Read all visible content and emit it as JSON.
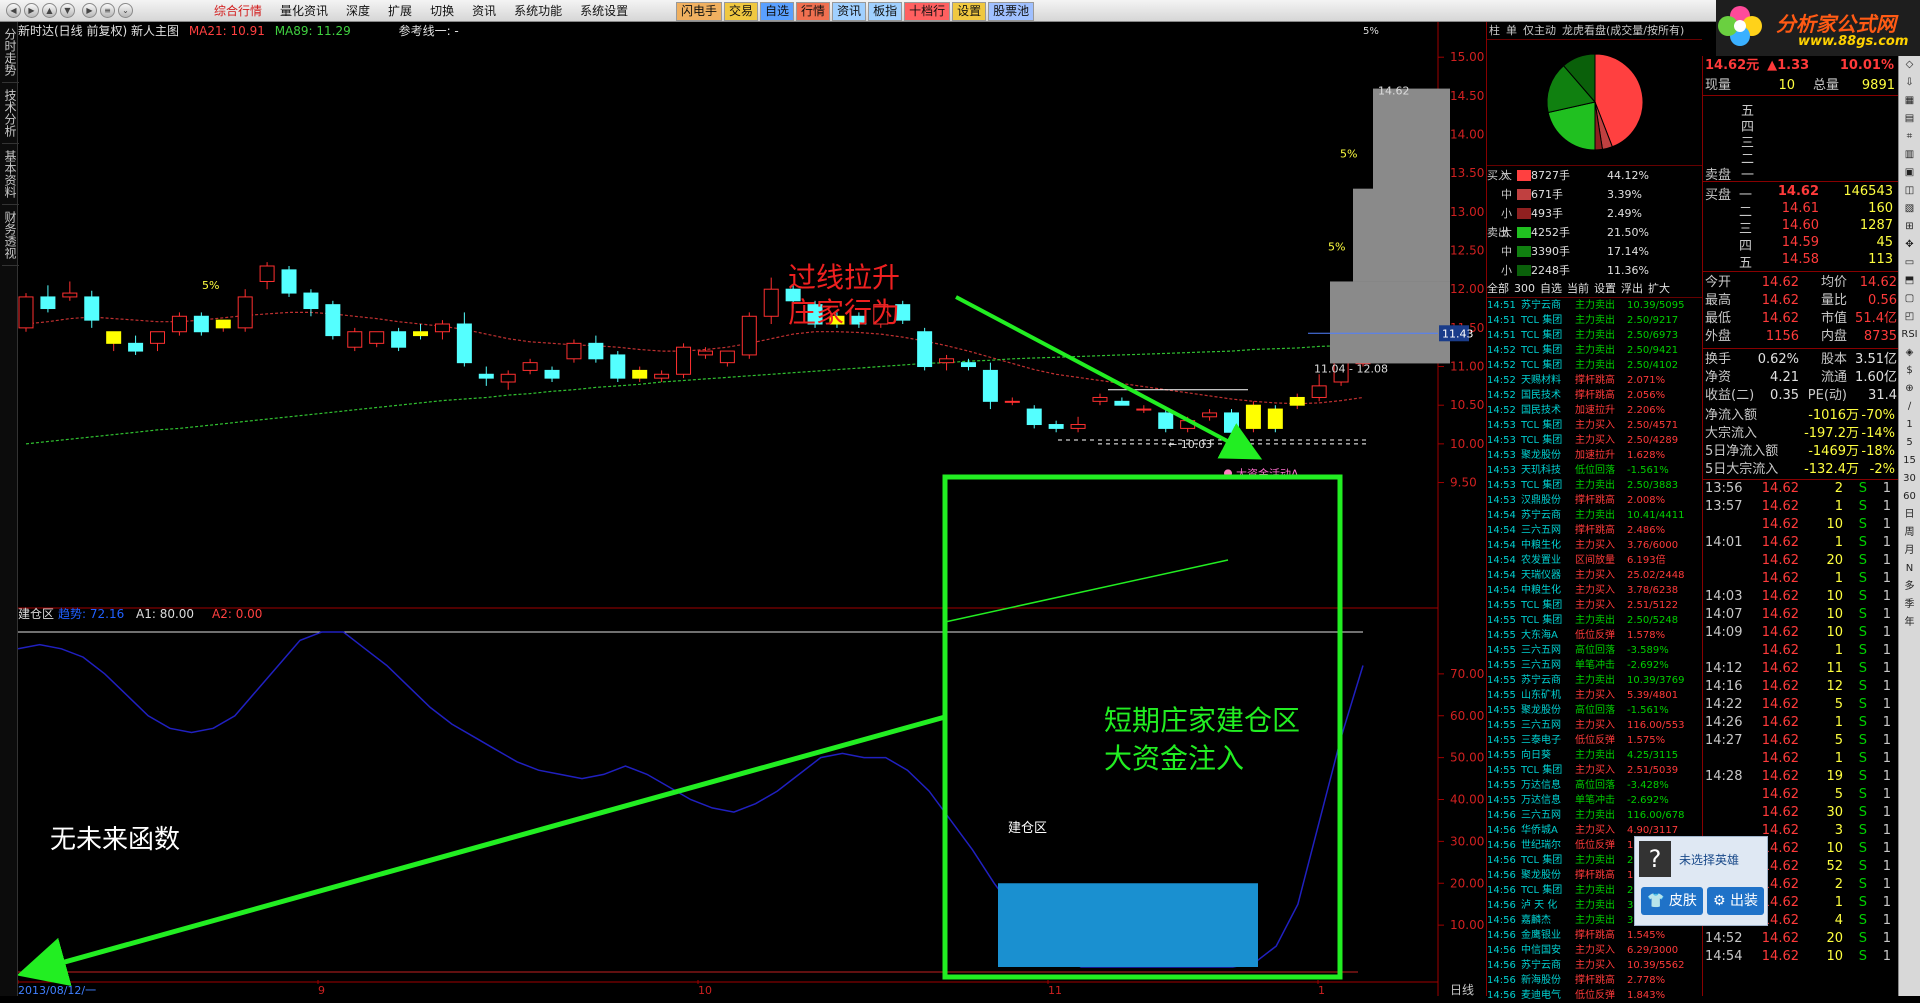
{
  "app": {
    "logo_name": "分析家公式网",
    "logo_url": "www.88gs.com"
  },
  "menu": [
    "综合行情",
    "量化资讯",
    "深度",
    "扩展",
    "切换",
    "资讯",
    "系统功能",
    "系统设置"
  ],
  "quick_buttons": [
    "闪电手",
    "交易",
    "自选",
    "行情",
    "资讯",
    "板指",
    "十档行",
    "设置",
    "股票池"
  ],
  "side_tabs": [
    "分时走势",
    "技术分析",
    "基本资料",
    "财务透视"
  ],
  "title": {
    "name": "新时达(日线 前复权) 新人主图",
    "ma21": "MA21: 10.91",
    "ma89": "MA89: 11.29",
    "ref": "参考线一: -"
  },
  "sub_title": {
    "name": "建仓区",
    "trend": "趋势: 72.16",
    "a1": "A1: 80.00",
    "a2": "A2: 0.00"
  },
  "price_axis": [
    "15.00",
    "14.50",
    "14.00",
    "13.50",
    "13.00",
    "12.50",
    "12.00",
    "11.50",
    "11.00",
    "10.50",
    "10.00",
    "9.50"
  ],
  "sub_axis": [
    "70.00",
    "60.00",
    "50.00",
    "40.00",
    "30.00",
    "20.00",
    "10.00"
  ],
  "date_axis": [
    "2013/08/12/一",
    "9",
    "10",
    "11",
    "1"
  ],
  "date_axis_end": "日线",
  "annotations": {
    "arrow_up_1": "过线拉升",
    "arrow_up_2": "庄家行为",
    "box_1": "短期庄家建仓区",
    "box_2": "大资金注入",
    "no_future": "无未来函数",
    "jianzang": "建仓区",
    "big_money": "大资金活动A",
    "range": "11.04 - 12.08",
    "low": "← 10.03",
    "hl_price": "11.43",
    "top_pct": "5%",
    "bar_price": "14.62"
  },
  "pct_labels": [
    "5%",
    "5%",
    "5%"
  ],
  "chart_data": {
    "type": "candlestick",
    "title": "新时达(日线 前复权) 新人主图",
    "ylim": [
      9.3,
      15.3
    ],
    "ohlc": [
      [
        11.5,
        11.95,
        11.45,
        11.9
      ],
      [
        11.9,
        12.05,
        11.7,
        11.75
      ],
      [
        11.9,
        12.1,
        11.85,
        11.95
      ],
      [
        11.9,
        11.98,
        11.5,
        11.6
      ],
      [
        11.3,
        11.45,
        11.2,
        11.45
      ],
      [
        11.3,
        11.4,
        11.15,
        11.2
      ],
      [
        11.3,
        11.45,
        11.2,
        11.45
      ],
      [
        11.45,
        11.7,
        11.4,
        11.65
      ],
      [
        11.65,
        11.7,
        11.4,
        11.45
      ],
      [
        11.5,
        11.6,
        11.45,
        11.6
      ],
      [
        11.5,
        12.0,
        11.45,
        11.9
      ],
      [
        12.1,
        12.35,
        12.0,
        12.3
      ],
      [
        12.25,
        12.3,
        11.9,
        11.95
      ],
      [
        11.95,
        12.0,
        11.65,
        11.75
      ],
      [
        11.8,
        11.85,
        11.35,
        11.4
      ],
      [
        11.25,
        11.5,
        11.2,
        11.45
      ],
      [
        11.3,
        11.45,
        11.25,
        11.45
      ],
      [
        11.45,
        11.5,
        11.2,
        11.25
      ],
      [
        11.45,
        11.55,
        11.35,
        11.4
      ],
      [
        11.45,
        11.6,
        11.35,
        11.55
      ],
      [
        11.55,
        11.7,
        11.0,
        11.05
      ],
      [
        10.9,
        11.0,
        10.75,
        10.85
      ],
      [
        10.8,
        10.95,
        10.7,
        10.9
      ],
      [
        10.95,
        11.1,
        10.9,
        11.05
      ],
      [
        10.95,
        11.0,
        10.8,
        10.85
      ],
      [
        11.1,
        11.35,
        11.05,
        11.3
      ],
      [
        11.3,
        11.4,
        11.05,
        11.1
      ],
      [
        11.15,
        11.2,
        10.8,
        10.85
      ],
      [
        10.85,
        11.0,
        10.8,
        10.95
      ],
      [
        10.85,
        10.95,
        10.8,
        10.9
      ],
      [
        10.9,
        11.3,
        10.85,
        11.25
      ],
      [
        11.15,
        11.25,
        11.1,
        11.2
      ],
      [
        11.05,
        11.2,
        11.0,
        11.2
      ],
      [
        11.15,
        11.7,
        11.1,
        11.65
      ],
      [
        11.65,
        12.15,
        11.55,
        12.0
      ],
      [
        12.0,
        12.05,
        11.75,
        11.85
      ],
      [
        11.8,
        11.85,
        11.5,
        11.55
      ],
      [
        11.65,
        11.7,
        11.5,
        11.55
      ],
      [
        11.65,
        11.7,
        11.5,
        11.55
      ],
      [
        11.55,
        11.8,
        11.5,
        11.8
      ],
      [
        11.8,
        11.85,
        11.55,
        11.6
      ],
      [
        11.45,
        11.5,
        10.95,
        11.0
      ],
      [
        11.05,
        11.15,
        10.95,
        11.1
      ],
      [
        11.05,
        11.1,
        10.95,
        11.0
      ],
      [
        10.95,
        11.05,
        10.45,
        10.55
      ],
      [
        10.55,
        10.6,
        10.5,
        10.55
      ],
      [
        10.45,
        10.5,
        10.2,
        10.25
      ],
      [
        10.25,
        10.3,
        10.15,
        10.2
      ],
      [
        10.2,
        10.35,
        10.15,
        10.25
      ],
      [
        10.55,
        10.65,
        10.5,
        10.6
      ],
      [
        10.55,
        10.6,
        10.5,
        10.5
      ],
      [
        10.45,
        10.5,
        10.4,
        10.45
      ],
      [
        10.4,
        10.45,
        10.15,
        10.2
      ],
      [
        10.2,
        10.35,
        10.15,
        10.3
      ],
      [
        10.35,
        10.45,
        10.3,
        10.4
      ],
      [
        10.4,
        10.45,
        10.15,
        10.15
      ],
      [
        10.2,
        10.55,
        10.15,
        10.5
      ],
      [
        10.45,
        10.5,
        10.15,
        10.2
      ],
      [
        10.5,
        10.65,
        10.45,
        10.6
      ],
      [
        10.6,
        10.9,
        10.55,
        10.75
      ],
      [
        10.8,
        11.05,
        10.75,
        11.05
      ],
      [
        11.05,
        11.1,
        11.0,
        11.05
      ]
    ],
    "ma21": [
      11.55,
      11.58,
      11.62,
      11.64,
      11.62,
      11.6,
      11.58,
      11.58,
      11.6,
      11.63,
      11.66,
      11.68,
      11.7,
      11.7,
      11.68,
      11.65,
      11.62,
      11.58,
      11.55,
      11.52,
      11.48,
      11.42,
      11.36,
      11.32,
      11.3,
      11.28,
      11.27,
      11.25,
      11.22,
      11.2,
      11.2,
      11.22,
      11.25,
      11.3,
      11.36,
      11.42,
      11.45,
      11.45,
      11.44,
      11.42,
      11.38,
      11.33,
      11.27,
      11.2,
      11.12,
      11.04,
      10.96,
      10.9,
      10.86,
      10.82,
      10.78,
      10.74,
      10.7,
      10.66,
      10.62,
      10.58,
      10.55,
      10.53,
      10.52,
      10.53,
      10.56,
      10.6
    ],
    "ma89": [
      10.0,
      10.03,
      10.06,
      10.09,
      10.12,
      10.15,
      10.18,
      10.2,
      10.23,
      10.26,
      10.29,
      10.32,
      10.35,
      10.38,
      10.41,
      10.44,
      10.47,
      10.5,
      10.53,
      10.56,
      10.58,
      10.6,
      10.63,
      10.65,
      10.68,
      10.7,
      10.73,
      10.75,
      10.77,
      10.8,
      10.82,
      10.84,
      10.86,
      10.88,
      10.9,
      10.92,
      10.94,
      10.96,
      10.98,
      11.0,
      11.02,
      11.04,
      11.05,
      11.07,
      11.08,
      11.1,
      11.11,
      11.12,
      11.13,
      11.14,
      11.15,
      11.16,
      11.17,
      11.18,
      11.19,
      11.2,
      11.22,
      11.23,
      11.24,
      11.26,
      11.27,
      11.29
    ],
    "trend": [
      76,
      77,
      76,
      74,
      70,
      65,
      60,
      57,
      56,
      57,
      60,
      66,
      72,
      78,
      80,
      80,
      76,
      72,
      67,
      62,
      58,
      55,
      52,
      49,
      47,
      46,
      45,
      46,
      48,
      46,
      43,
      40,
      38,
      37,
      39,
      42,
      46,
      50,
      51,
      50,
      50,
      47,
      42,
      35,
      28,
      20,
      13,
      7,
      3,
      0,
      0,
      0,
      0,
      0,
      0,
      0,
      0,
      1,
      5,
      15,
      35,
      55,
      72
    ],
    "sub_ylim": [
      0,
      80
    ]
  },
  "right_panel": {
    "tabs": [
      "柱",
      "单",
      "仅主动",
      "龙虎看盘(成交量/按所有)"
    ],
    "bottom_tabs": [
      "全部",
      "300",
      "自选",
      "当前",
      "设置",
      "浮出",
      "扩大"
    ],
    "flows": [
      {
        "side": "买入",
        "size": "大",
        "vol": "8727手",
        "pct": "44.12%",
        "c": "#ff4040"
      },
      {
        "side": "",
        "size": "中",
        "vol": "671手",
        "pct": "3.39%",
        "c": "#c04040"
      },
      {
        "side": "",
        "size": "小",
        "vol": "493手",
        "pct": "2.49%",
        "c": "#902020"
      },
      {
        "side": "卖出",
        "size": "大",
        "vol": "4252手",
        "pct": "21.50%",
        "c": "#20c020"
      },
      {
        "side": "",
        "size": "中",
        "vol": "3390手",
        "pct": "17.14%",
        "c": "#108010"
      },
      {
        "side": "",
        "size": "小",
        "vol": "2248手",
        "pct": "11.36%",
        "c": "#0a600a"
      }
    ],
    "pie": [
      44.12,
      3.39,
      2.49,
      21.5,
      17.14,
      11.36
    ],
    "ticks": [
      [
        "14:51",
        "苏宁云商",
        "主力卖出",
        "10.39/5095"
      ],
      [
        "14:51",
        "TCL 集团",
        "主力卖出",
        "2.50/9217"
      ],
      [
        "14:51",
        "TCL 集团",
        "主力卖出",
        "2.50/6973"
      ],
      [
        "14:52",
        "TCL 集团",
        "主力卖出",
        "2.50/9421"
      ],
      [
        "14:52",
        "TCL 集团",
        "主力卖出",
        "2.50/4102"
      ],
      [
        "14:52",
        "天赐材料",
        "撑杆跳高",
        "2.071%"
      ],
      [
        "14:52",
        "国民技术",
        "撑杆跳高",
        "2.056%"
      ],
      [
        "14:52",
        "国民技术",
        "加速拉升",
        "2.206%"
      ],
      [
        "14:53",
        "TCL 集团",
        "主力买入",
        "2.50/4571"
      ],
      [
        "14:53",
        "TCL 集团",
        "主力买入",
        "2.50/4289"
      ],
      [
        "14:53",
        "聚龙股份",
        "加速拉升",
        "1.628%"
      ],
      [
        "14:53",
        "天玑科技",
        "低位回落",
        "-1.561%"
      ],
      [
        "14:53",
        "TCL 集团",
        "主力卖出",
        "2.50/3883"
      ],
      [
        "14:53",
        "汉鼎股份",
        "撑杆跳高",
        "2.008%"
      ],
      [
        "14:54",
        "苏宁云商",
        "主力卖出",
        "10.41/4411"
      ],
      [
        "14:54",
        "三六五网",
        "撑杆跳高",
        "2.486%"
      ],
      [
        "14:54",
        "中粮生化",
        "主力买入",
        "3.76/6000"
      ],
      [
        "14:54",
        "农发置业",
        "区间放量",
        "6.193倍"
      ],
      [
        "14:54",
        "天瑞仪器",
        "主力买入",
        "25.02/2448"
      ],
      [
        "14:54",
        "中粮生化",
        "主力买入",
        "3.78/6238"
      ],
      [
        "14:55",
        "TCL 集团",
        "主力买入",
        "2.51/5122"
      ],
      [
        "14:55",
        "TCL 集团",
        "主力卖出",
        "2.50/5248"
      ],
      [
        "14:55",
        "大东海A",
        "低位反弹",
        "1.578%"
      ],
      [
        "14:55",
        "三六五网",
        "高位回落",
        "-3.589%"
      ],
      [
        "14:55",
        "三六五网",
        "单笔冲击",
        "-2.692%"
      ],
      [
        "14:55",
        "苏宁云商",
        "主力卖出",
        "10.39/3769"
      ],
      [
        "14:55",
        "山东矿机",
        "主力买入",
        "5.39/4801"
      ],
      [
        "14:55",
        "聚龙股份",
        "高位回落",
        "-1.561%"
      ],
      [
        "14:55",
        "三六五网",
        "主力买入",
        "116.00/553"
      ],
      [
        "14:55",
        "三泰电子",
        "低位反弹",
        "1.575%"
      ],
      [
        "14:55",
        "向日葵",
        "主力卖出",
        "4.25/3115"
      ],
      [
        "14:55",
        "TCL 集团",
        "主力买入",
        "2.51/5039"
      ],
      [
        "14:55",
        "万达信息",
        "高位回落",
        "-3.428%"
      ],
      [
        "14:55",
        "万达信息",
        "单笔冲击",
        "-2.692%"
      ],
      [
        "14:56",
        "三六五网",
        "主力卖出",
        "116.00/678"
      ],
      [
        "14:56",
        "华侨城A",
        "主力买入",
        "4.90/3117"
      ],
      [
        "14:56",
        "世纪瑞尔",
        "低位反弹",
        "1.511%"
      ],
      [
        "14:56",
        "TCL 集团",
        "主力卖出",
        "2.50/5100"
      ],
      [
        "14:56",
        "聚龙股份",
        "撑杆跳高",
        "1.612%"
      ],
      [
        "14:56",
        "TCL 集团",
        "主力卖出",
        "2.50/4330"
      ],
      [
        "14:56",
        "泸 天 化",
        "主力卖出",
        "3.12/4610"
      ],
      [
        "14:56",
        "嘉麟杰",
        "主力卖出",
        "3.36/3500"
      ],
      [
        "14:56",
        "金鹰银业",
        "撑杆跳高",
        "1.545%"
      ],
      [
        "14:56",
        "中信国安",
        "主力买入",
        "6.29/3000"
      ],
      [
        "14:56",
        "苏宁云商",
        "主力买入",
        "10.39/5562"
      ],
      [
        "14:56",
        "新海股份",
        "撑杆跳高",
        "2.778%"
      ],
      [
        "14:56",
        "麦迪电气",
        "低位反弹",
        "1.843%"
      ]
    ]
  },
  "quote": {
    "price": "14.62元",
    "chg": "▲1.33",
    "pct": "10.01%",
    "now_label": "现量",
    "now": "10",
    "total_label": "总量",
    "total": "9891",
    "sells": [
      "五",
      "四",
      "三",
      "二",
      "一"
    ],
    "sell_title": "卖盘",
    "buy_title": "买盘",
    "buys": [
      [
        "一",
        "14.62",
        "146543"
      ],
      [
        "二",
        "14.61",
        "160"
      ],
      [
        "三",
        "14.60",
        "1287"
      ],
      [
        "四",
        "14.59",
        "45"
      ],
      [
        "五",
        "14.58",
        "113"
      ]
    ],
    "stats": [
      [
        "今开",
        "14.62",
        "均价",
        "14.62"
      ],
      [
        "最高",
        "14.62",
        "量比",
        "0.56"
      ],
      [
        "最低",
        "14.62",
        "市值",
        "51.4亿"
      ],
      [
        "外盘",
        "1156",
        "内盘",
        "8735"
      ]
    ],
    "stats2": [
      [
        "换手",
        "0.62%",
        "股本",
        "3.51亿"
      ],
      [
        "净资",
        "4.21",
        "流通",
        "1.60亿"
      ],
      [
        "收益(二)",
        "0.35",
        "PE(动)",
        "31.4"
      ]
    ],
    "flows": [
      [
        "净流入额",
        "-1016万",
        "-70%"
      ],
      [
        "大宗流入",
        "-197.2万",
        "-14%"
      ],
      [
        "5日净流入额",
        "-1469万",
        "-18%"
      ],
      [
        "5日大宗流入",
        "-132.4万",
        "-2%"
      ]
    ],
    "trades": [
      [
        "13:56",
        "14.62",
        "2",
        "S",
        "1"
      ],
      [
        "13:57",
        "14.62",
        "1",
        "S",
        "1"
      ],
      [
        "",
        "14.62",
        "10",
        "S",
        "1"
      ],
      [
        "14:01",
        "14.62",
        "1",
        "S",
        "1"
      ],
      [
        "",
        "14.62",
        "20",
        "S",
        "1"
      ],
      [
        "",
        "14.62",
        "1",
        "S",
        "1"
      ],
      [
        "14:03",
        "14.62",
        "10",
        "S",
        "1"
      ],
      [
        "14:07",
        "14.62",
        "10",
        "S",
        "1"
      ],
      [
        "14:09",
        "14.62",
        "10",
        "S",
        "1"
      ],
      [
        "",
        "14.62",
        "1",
        "S",
        "1"
      ],
      [
        "14:12",
        "14.62",
        "11",
        "S",
        "1"
      ],
      [
        "14:16",
        "14.62",
        "12",
        "S",
        "1"
      ],
      [
        "14:22",
        "14.62",
        "5",
        "S",
        "1"
      ],
      [
        "14:26",
        "14.62",
        "1",
        "S",
        "1"
      ],
      [
        "14:27",
        "14.62",
        "5",
        "S",
        "1"
      ],
      [
        "",
        "14.62",
        "1",
        "S",
        "1"
      ],
      [
        "14:28",
        "14.62",
        "19",
        "S",
        "1"
      ],
      [
        "",
        "14.62",
        "5",
        "S",
        "1"
      ],
      [
        "",
        "14.62",
        "30",
        "S",
        "1"
      ],
      [
        "",
        "14.62",
        "3",
        "S",
        "1"
      ],
      [
        "",
        "14.62",
        "10",
        "S",
        "1"
      ],
      [
        "",
        "14.62",
        "52",
        "S",
        "1"
      ],
      [
        "",
        "14.62",
        "2",
        "S",
        "1"
      ],
      [
        "",
        "14.62",
        "1",
        "S",
        "1"
      ],
      [
        "",
        "14.62",
        "4",
        "S",
        "1"
      ],
      [
        "14:52",
        "14.62",
        "20",
        "S",
        "1"
      ],
      [
        "14:54",
        "14.62",
        "10",
        "S",
        "1"
      ]
    ]
  },
  "hero": {
    "title": "未选择英雄",
    "skin": "皮肤",
    "go": "出装"
  },
  "rtool": [
    "◇",
    "⇩",
    "▦",
    "▤",
    "⌗",
    "▥",
    "▣",
    "◫",
    "▧",
    "⊞",
    "✥",
    "▭",
    "⬒",
    "▢",
    "◰",
    "RSI",
    "◈",
    "$",
    "⊕",
    "∕",
    "1",
    "5",
    "15",
    "30",
    "60",
    "日",
    "周",
    "月",
    "N",
    "多",
    "季",
    "年"
  ]
}
